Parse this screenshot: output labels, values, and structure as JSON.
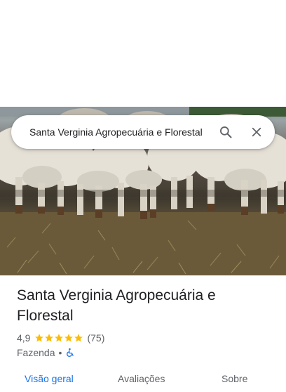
{
  "search": {
    "value": "Santa Verginia Agropecuária e Florestal"
  },
  "place": {
    "name": "Santa Verginia Agropecuária e Florestal",
    "rating": "4,9",
    "stars": 5,
    "review_count": "(75)",
    "category": "Fazenda",
    "separator": "•",
    "accessibility_icon": "wheelchair-icon"
  },
  "tabs": [
    {
      "label": "Visão geral",
      "active": true
    },
    {
      "label": "Avaliações",
      "active": false
    },
    {
      "label": "Sobre",
      "active": false
    }
  ],
  "colors": {
    "accent": "#1a73e8",
    "star": "#fbbc04",
    "text_primary": "#202124",
    "text_secondary": "#5f6368"
  }
}
